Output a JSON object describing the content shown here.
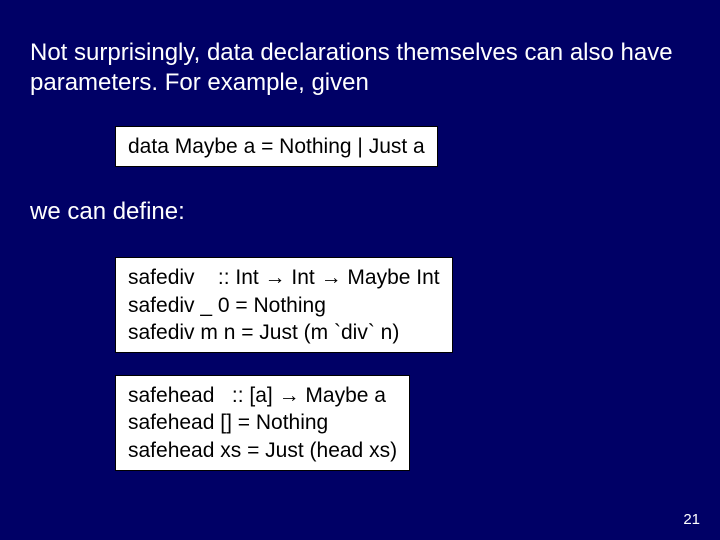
{
  "intro": "Not surprisingly, data declarations themselves can also have parameters.  For example, given",
  "code_block1": "data Maybe a = Nothing | Just a",
  "mid": "we can define:",
  "code_block2": "safediv    :: Int → Int → Maybe Int\nsafediv _ 0 = Nothing\nsafediv m n = Just (m `div` n)",
  "code_block3": "safehead   :: [a] → Maybe a\nsafehead [] = Nothing\nsafehead xs = Just (head xs)",
  "page_number": "21"
}
